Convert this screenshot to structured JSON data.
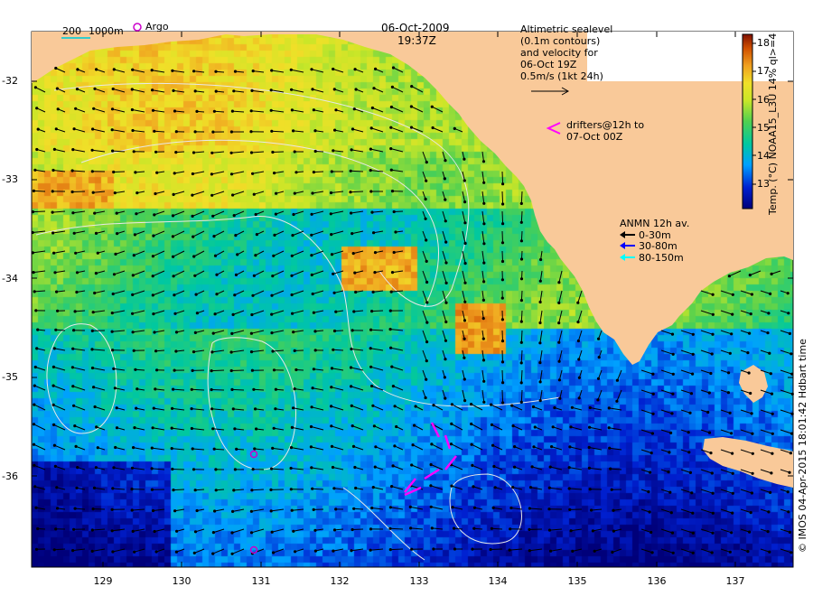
{
  "map": {
    "date": "06-Oct-2009",
    "time": "19:37Z",
    "depth_legend": {
      "value1": "200",
      "value2": "1000m"
    },
    "argo_label": "Argo",
    "altimetry_note": [
      "Altimetric sealevel",
      "(0.1m contours)",
      "and velocity for",
      "06-Oct 19Z",
      "0.5m/s (1kt 24h)"
    ],
    "drifters_note": [
      "drifters@12h to",
      "07-Oct 00Z"
    ],
    "anmn": {
      "title": "ANMN 12h av.",
      "items": [
        {
          "label": "0-30m",
          "color": "#000000"
        },
        {
          "label": "30-80m",
          "color": "#0000ff"
        },
        {
          "label": "80-150m",
          "color": "#00ffff"
        }
      ]
    },
    "colorbar": {
      "title": "Temp. (°C) NOAA15_L3U 14% ql>=4",
      "ticks": [
        "18",
        "17",
        "16",
        "15",
        "14",
        "13"
      ],
      "range": [
        12.3,
        18.4
      ]
    },
    "copyright": "© IMOS 04-Apr-2015 18:01:42 Hdbart time",
    "axes": {
      "x_ticks": [
        "129",
        "130",
        "131",
        "132",
        "133",
        "134",
        "135",
        "136",
        "137"
      ],
      "y_ticks": [
        "-32",
        "-33",
        "-34",
        "-35",
        "-36"
      ],
      "lon_range": [
        128.2,
        137.5
      ],
      "lat_range": [
        -36.9,
        -31.4
      ]
    },
    "colors": {
      "land": "#f9c999",
      "argo": "#cc00cc",
      "drifter": "#ff00ff",
      "contour": "#e8e8e8"
    }
  }
}
